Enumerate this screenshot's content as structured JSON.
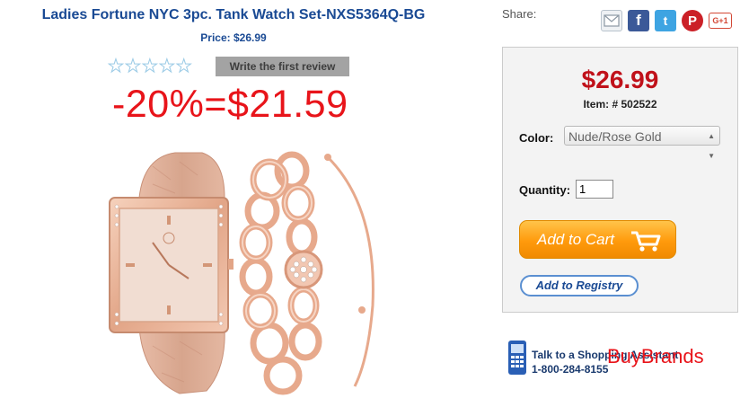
{
  "product": {
    "title": "Ladies Fortune NYC 3pc. Tank Watch Set-NXS5364Q-BG",
    "price_line": "Price: $26.99",
    "rating_stars": 0,
    "review_button": "Write the first review",
    "discount_text": "-20%=$21.59"
  },
  "share": {
    "label": "Share:",
    "icons": [
      "mail-icon",
      "facebook-icon",
      "twitter-icon",
      "pinterest-icon",
      "google-plus-icon"
    ],
    "google_plus_text": "G+1"
  },
  "buybox": {
    "price": "$26.99",
    "item_number": "Item: # 502522",
    "color_label": "Color:",
    "color_selected": "Nude/Rose Gold",
    "quantity_label": "Quantity:",
    "quantity_value": "1",
    "add_to_cart": "Add to Cart",
    "add_to_registry": "Add to Registry"
  },
  "assistant": {
    "line1": "Talk to a Shopping Assistant",
    "line2": "1-800-284-8155"
  },
  "watermark": "BuyBrands",
  "colors": {
    "title_blue": "#1a4a94",
    "price_red": "#c0111a",
    "discount_red": "#e8141a",
    "cart_orange": "#ff9a0c",
    "rose_gold": "#e8b49a",
    "nude_strap": "#dcae97"
  }
}
